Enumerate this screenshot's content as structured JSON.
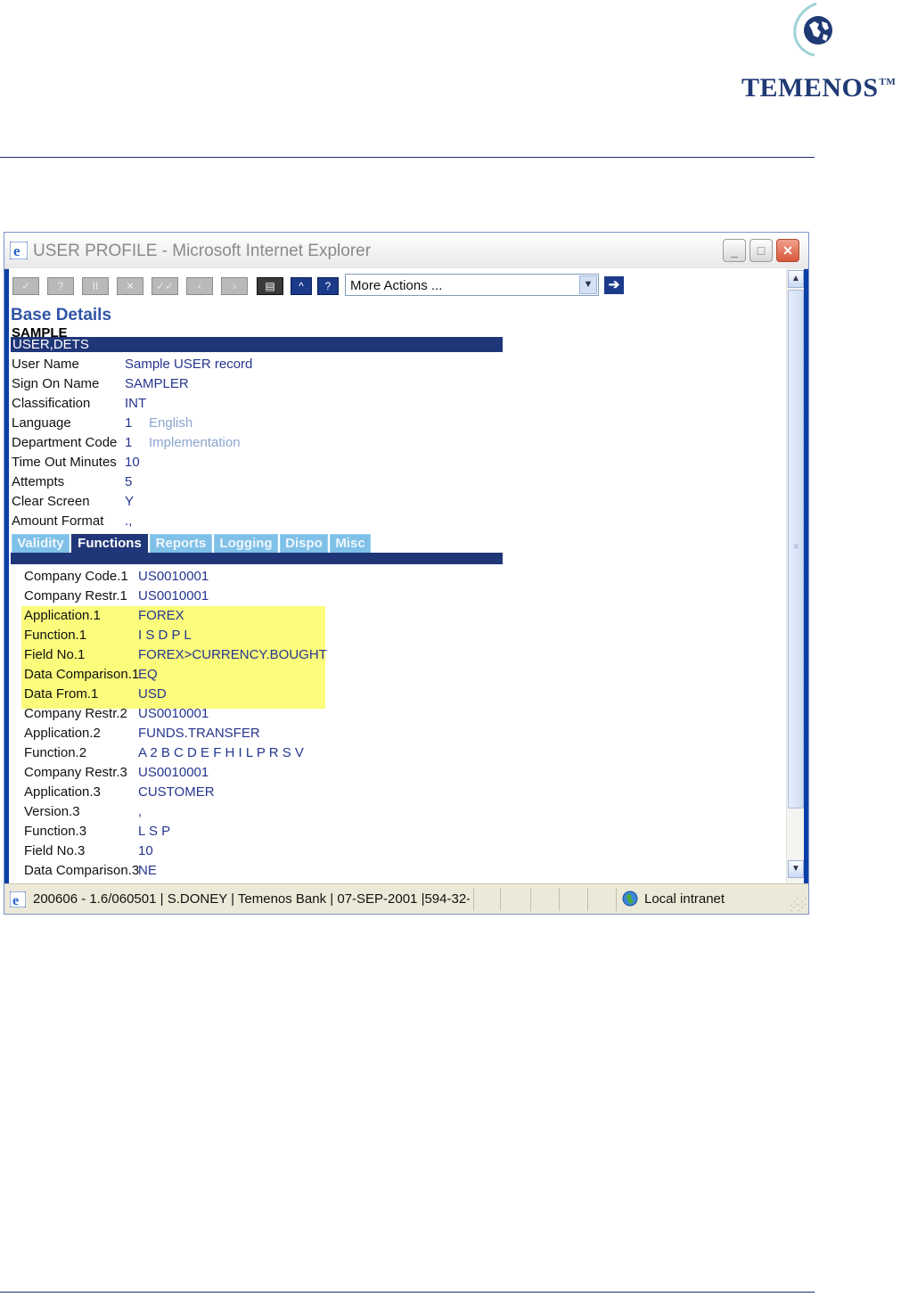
{
  "doc": {
    "brand": "TEMENOS",
    "trademark": "TM"
  },
  "window": {
    "title": "USER PROFILE - Microsoft Internet Explorer",
    "minimize_label": "_",
    "maximize_label": "□",
    "close_label": "✕"
  },
  "toolbar": {
    "buttons": [
      "✓",
      "?",
      "II",
      "✕",
      "✓✓",
      "‹",
      "›",
      "▤",
      "^",
      "?"
    ],
    "more_actions": "More Actions ...",
    "dropdown_arrow": "▼",
    "go": "➔"
  },
  "form": {
    "section_title": "Base Details",
    "record_id": "SAMPLE",
    "version": "USER,DETS",
    "fields": [
      {
        "label": "User Name",
        "value": "Sample USER record",
        "enrich": ""
      },
      {
        "label": "Sign On Name",
        "value": "SAMPLER",
        "enrich": ""
      },
      {
        "label": "Classification",
        "value": "INT",
        "enrich": ""
      },
      {
        "label": "Language",
        "value": "1",
        "enrich": "English"
      },
      {
        "label": "Department Code",
        "value": "1",
        "enrich": "Implementation"
      },
      {
        "label": "Time Out Minutes",
        "value": "10",
        "enrich": ""
      },
      {
        "label": "Attempts",
        "value": "5",
        "enrich": ""
      },
      {
        "label": "Clear Screen",
        "value": "Y",
        "enrich": ""
      },
      {
        "label": "Amount Format",
        "value": ".,",
        "enrich": ""
      }
    ],
    "tabs": [
      "Validity",
      "Functions",
      "Reports",
      "Logging",
      "Dispo",
      "Misc"
    ],
    "active_tab": "Functions",
    "function_fields": [
      {
        "label": "Company Code.1",
        "value": "US0010001"
      },
      {
        "label": "Company Restr.1",
        "value": "US0010001"
      },
      {
        "label": "Application.1",
        "value": "FOREX"
      },
      {
        "label": "Function.1",
        "value": "I S D P L"
      },
      {
        "label": "Field No.1",
        "value": "FOREX>CURRENCY.BOUGHT"
      },
      {
        "label": "Data Comparison.1",
        "value": "EQ"
      },
      {
        "label": "Data From.1",
        "value": "USD"
      },
      {
        "label": "Company Restr.2",
        "value": "US0010001"
      },
      {
        "label": "Application.2",
        "value": "FUNDS.TRANSFER"
      },
      {
        "label": "Function.2",
        "value": "A 2 B C D E F H I L P R S V"
      },
      {
        "label": "Company Restr.3",
        "value": "US0010001"
      },
      {
        "label": "Application.3",
        "value": "CUSTOMER"
      },
      {
        "label": "Version.3",
        "value": ","
      },
      {
        "label": "Function.3",
        "value": "L S P"
      },
      {
        "label": "Field No.3",
        "value": "10"
      },
      {
        "label": "Data Comparison.3",
        "value": "NE"
      }
    ],
    "highlight_color": "#fbfb7c"
  },
  "scrollbar": {
    "up": "▲",
    "down": "▼",
    "grip": "≡"
  },
  "statusbar": {
    "text": "200606 - 1.6/060501 | S.DONEY | Temenos Bank | 07-SEP-2001 |594-32-!",
    "zone": "Local intranet"
  }
}
